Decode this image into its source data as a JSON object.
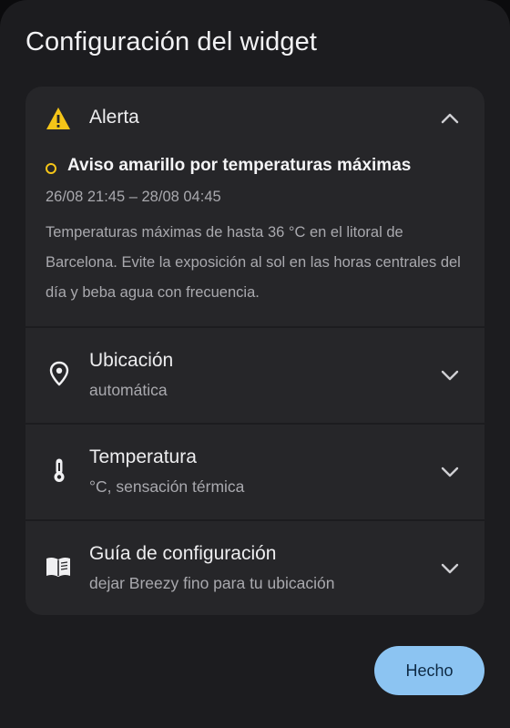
{
  "dialog": {
    "title": "Configuración del widget"
  },
  "alert": {
    "header": "Alerta",
    "warning_title": "Aviso amarillo por temperaturas máximas",
    "date_range": "26/08 21:45 – 28/08 04:45",
    "description": "Temperaturas máximas de hasta 36 °C en el litoral de Barcelona. Evite la exposición al sol en las horas centrales del día y beba agua con frecuencia.",
    "warning_color": "#f5c518",
    "expanded": true
  },
  "settings": [
    {
      "icon": "location-pin-icon",
      "title": "Ubicación",
      "subtitle": "automática"
    },
    {
      "icon": "thermometer-icon",
      "title": "Temperatura",
      "subtitle": "°C, sensación térmica"
    },
    {
      "icon": "book-icon",
      "title": "Guía de configuración",
      "subtitle": "dejar Breezy fino para tu ubicación"
    }
  ],
  "actions": {
    "done_label": "Hecho",
    "accent": "#8cc4f2"
  }
}
